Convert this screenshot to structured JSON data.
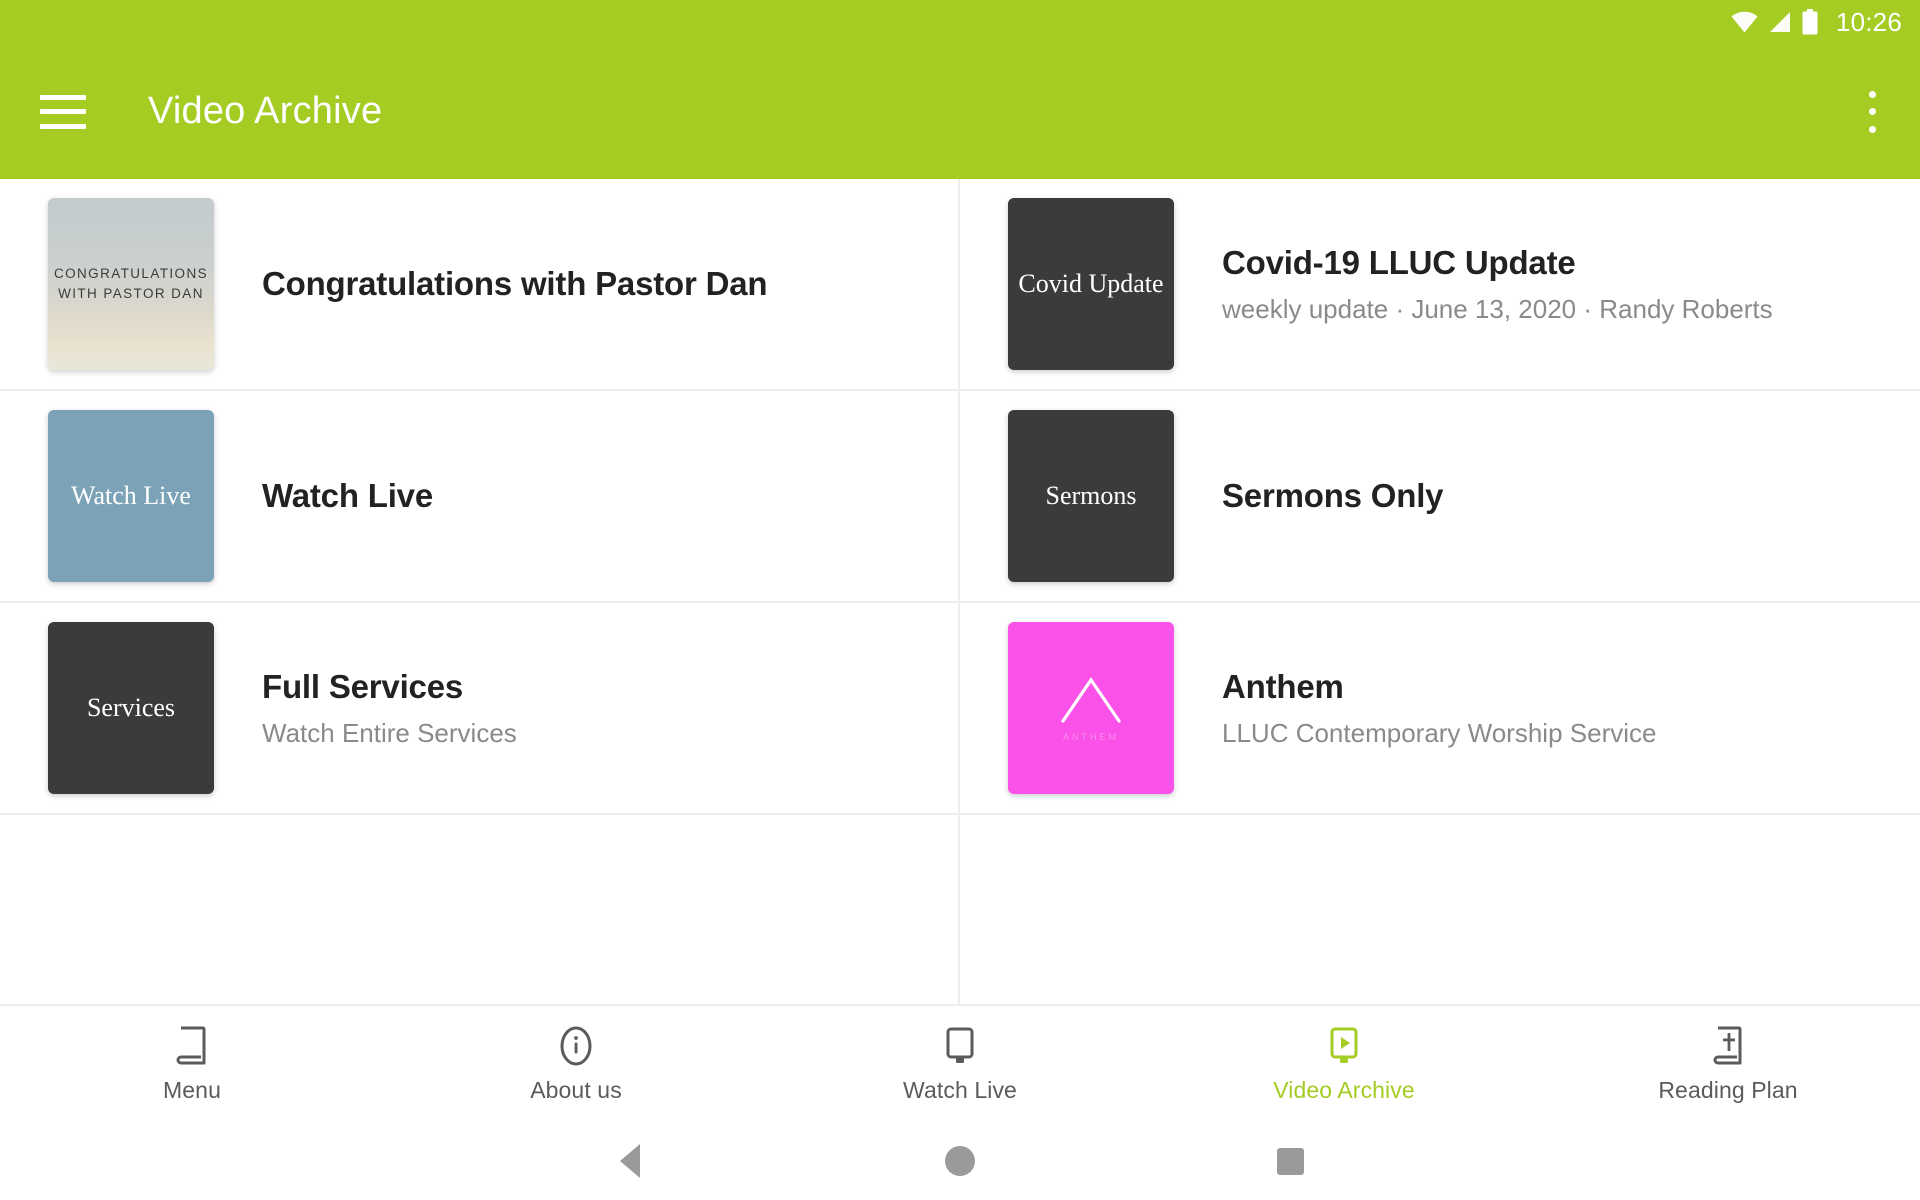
{
  "theme": {
    "accent": "#a4cc23",
    "app_bar_bg": "#a4cc23",
    "page_bg": "#ffffff",
    "divider": "#eeeeee",
    "title_color": "#222222",
    "subtitle_color": "#8a8a8a",
    "nav_inactive": "#5b5b5b",
    "nav_active": "#a4cc23"
  },
  "status_bar": {
    "time": "10:26",
    "icons": [
      "wifi-icon",
      "cellular-signal-icon",
      "battery-icon"
    ]
  },
  "app_bar": {
    "menu_icon": "hamburger-menu-icon",
    "title": "Video Archive",
    "overflow_icon": "overflow-menu-icon"
  },
  "list": {
    "items": [
      {
        "title": "Congratulations with Pastor Dan",
        "subtitle": "",
        "thumb_style": "congrats",
        "thumb_label": "CONGRATULATIONS WITH PASTOR DAN",
        "thumb_color": "#cfd2cd"
      },
      {
        "title": "Covid-19 LLUC Update",
        "subtitle": "weekly update · June 13, 2020 · Randy Roberts",
        "thumb_style": "dark",
        "thumb_label": "Covid Update",
        "thumb_color": "#3b3b3b"
      },
      {
        "title": "Watch Live",
        "subtitle": "",
        "thumb_style": "blue",
        "thumb_label": "Watch Live",
        "thumb_color": "#7ba2b7"
      },
      {
        "title": "Sermons Only",
        "subtitle": "",
        "thumb_style": "dark",
        "thumb_label": "Sermons",
        "thumb_color": "#3b3b3b"
      },
      {
        "title": "Full Services",
        "subtitle": "Watch Entire Services",
        "thumb_style": "dark",
        "thumb_label": "Services",
        "thumb_color": "#3b3b3b"
      },
      {
        "title": "Anthem",
        "subtitle": "LLUC Contemporary Worship Service",
        "thumb_style": "pink",
        "thumb_label": "ANTHEM",
        "thumb_color": "#fa52e8"
      }
    ]
  },
  "bottom_nav": {
    "items": [
      {
        "label": "Menu",
        "icon": "book-icon",
        "active": false
      },
      {
        "label": "About us",
        "icon": "info-circle-icon",
        "active": false
      },
      {
        "label": "Watch Live",
        "icon": "monitor-icon",
        "active": false
      },
      {
        "label": "Video Archive",
        "icon": "video-play-icon",
        "active": true
      },
      {
        "label": "Reading Plan",
        "icon": "bible-cross-icon",
        "active": false
      }
    ]
  },
  "system_nav": {
    "back": "back-triangle-icon",
    "home": "home-circle-icon",
    "recents": "recents-square-icon"
  }
}
